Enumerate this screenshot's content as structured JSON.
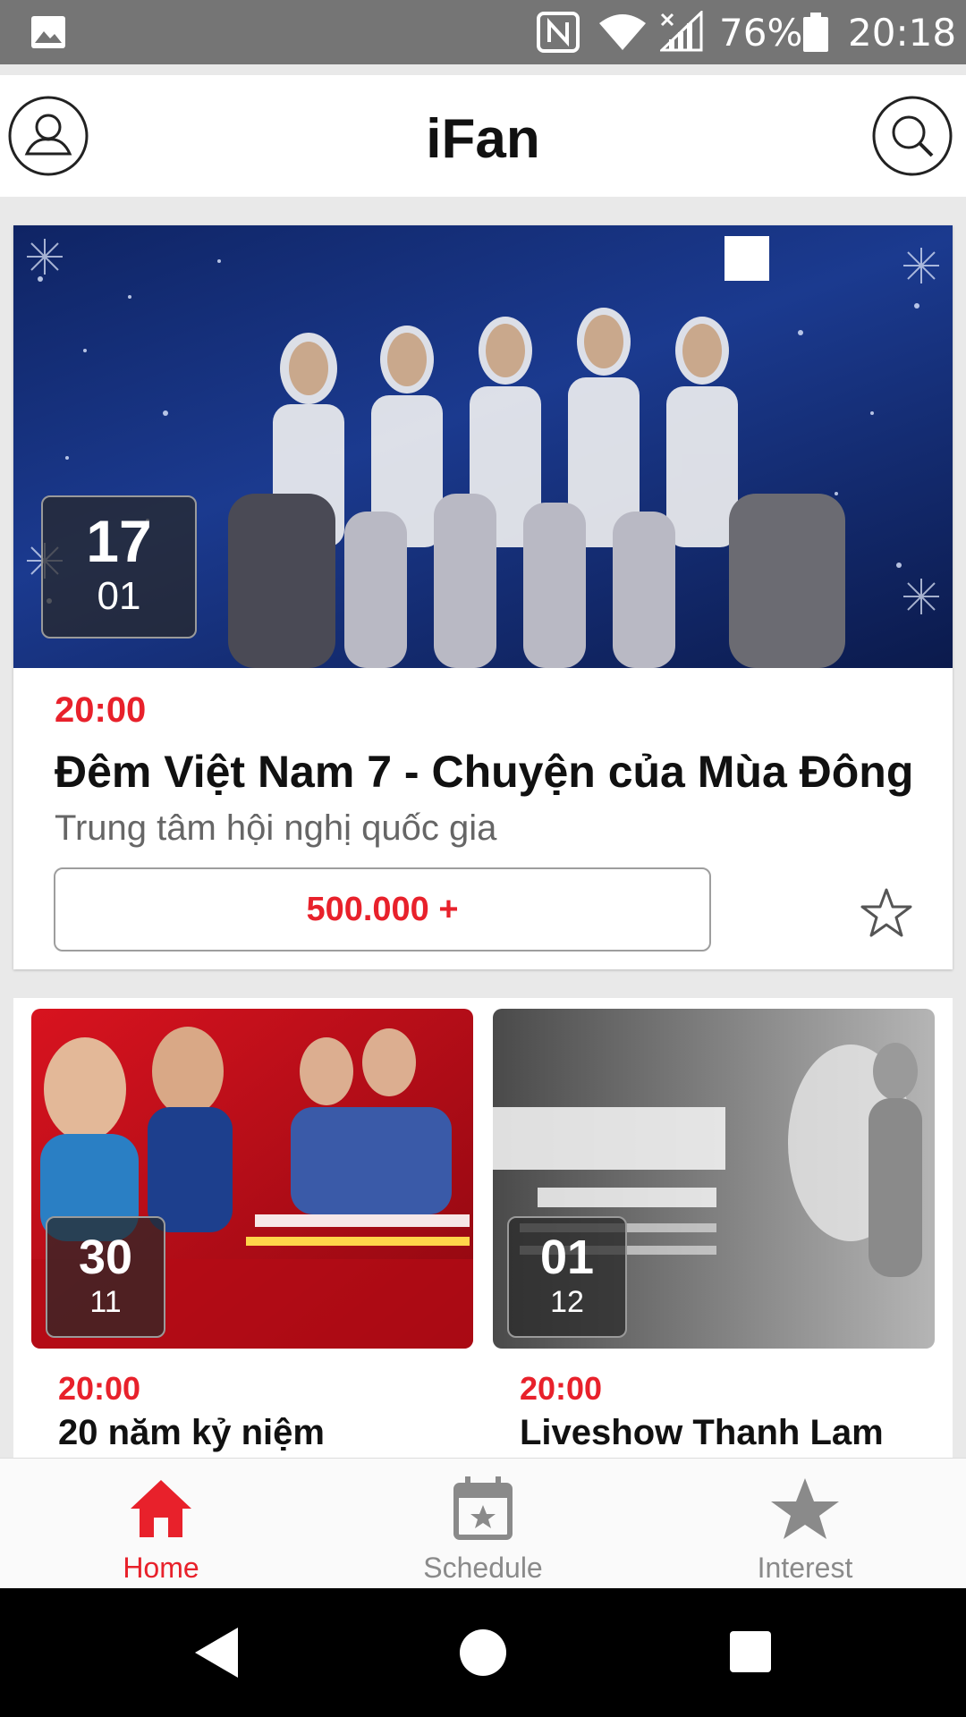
{
  "status_bar": {
    "battery_percent": "76%",
    "time": "20:18",
    "icons": [
      "gallery-icon",
      "nfc-icon",
      "wifi-icon",
      "signal-icon",
      "battery-icon"
    ]
  },
  "header": {
    "title": "iFan",
    "left_icon": "profile-icon",
    "right_icon": "search-icon"
  },
  "featured_event": {
    "day": "17",
    "month": "01",
    "time": "20:00",
    "title": "Đêm Việt Nam 7 - Chuyện của Mùa Đông",
    "venue": "Trung tâm hội nghị quốc gia",
    "price": "500.000 +",
    "favorite_icon": "star-outline-icon"
  },
  "events": [
    {
      "day": "30",
      "month": "11",
      "time": "20:00",
      "title": "20 năm kỷ niệm"
    },
    {
      "day": "01",
      "month": "12",
      "time": "20:00",
      "title": "Liveshow Thanh Lam"
    }
  ],
  "bottom_nav": {
    "items": [
      {
        "label": "Home",
        "icon": "home-icon",
        "active": true
      },
      {
        "label": "Schedule",
        "icon": "calendar-icon",
        "active": false
      },
      {
        "label": "Interest",
        "icon": "star-icon",
        "active": false
      }
    ]
  },
  "colors": {
    "accent": "#e8212b",
    "inactive": "#8a8a8a",
    "status_bar": "#757575"
  }
}
